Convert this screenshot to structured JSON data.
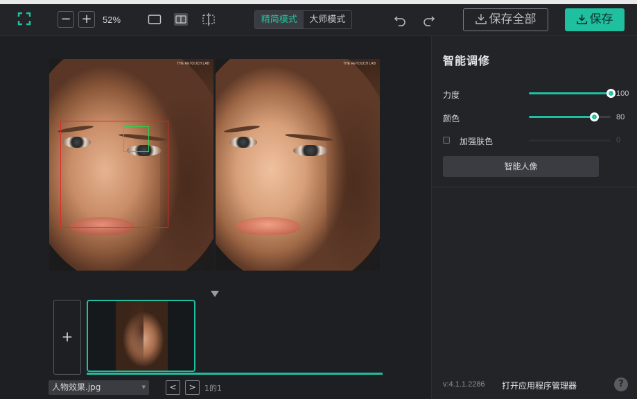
{
  "toolbar": {
    "logo_icon": "crop-frame-icon",
    "zoom_out_label": "−",
    "zoom_in_label": "+",
    "zoom_level": "52%",
    "view_icons": [
      "single-view-icon",
      "split-view-icon",
      "compare-view-icon"
    ],
    "modes": [
      {
        "label": "精简模式",
        "active": true
      },
      {
        "label": "大师模式",
        "active": false
      }
    ],
    "undo_icon": "undo-icon",
    "redo_icon": "redo-icon",
    "save_all_label": "保存全部",
    "save_label": "保存",
    "accent_color": "#1ec0a0"
  },
  "canvas": {
    "watermark": "THE RETOUCH LAB",
    "collapse_icon": "triangle-down-icon",
    "add_label": "+",
    "filename": "人物效果.jpg",
    "prev_label": "<",
    "next_label": ">",
    "page_info": "1的1"
  },
  "panel": {
    "title": "智能调修",
    "sliders": [
      {
        "label": "力度",
        "value": "100",
        "level": 1.0
      },
      {
        "label": "颜色",
        "value": "80",
        "level": 0.8
      }
    ],
    "enhance_skin": {
      "label": "加强肤色",
      "value": "0",
      "checked": false
    },
    "smart_portrait_label": "智能人像",
    "version": "v:4.1.1.2286",
    "open_manager_label": "打开应用程序管理器",
    "help_label": "?"
  }
}
